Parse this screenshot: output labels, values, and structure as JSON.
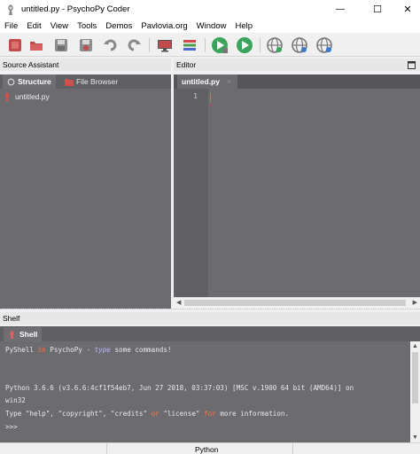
{
  "window": {
    "title": "untitled.py - PsychoPy Coder",
    "minimize_glyph": "—",
    "maximize_glyph": "☐",
    "close_glyph": "✕"
  },
  "menu": [
    "File",
    "Edit",
    "View",
    "Tools",
    "Demos",
    "Pavlovia.org",
    "Window",
    "Help"
  ],
  "toolbar": {
    "icons": [
      "new-file-icon",
      "open-folder-icon",
      "save-icon",
      "save-as-icon",
      "undo-icon",
      "redo-icon",
      "monitor-icon",
      "color-picker-icon",
      "run-icon",
      "run-green-icon",
      "pavlovia-sync-icon",
      "pavlovia-search-icon",
      "pavlovia-user-icon"
    ]
  },
  "source_assistant": {
    "header": "Source Assistant",
    "tabs": [
      {
        "label": "Structure",
        "active": true
      },
      {
        "label": "File Browser",
        "active": false
      }
    ],
    "tree": [
      {
        "label": "untitled.py"
      }
    ]
  },
  "editor": {
    "header": "Editor",
    "tab_label": "untitled.py",
    "tab_close": "×",
    "line_number": "1"
  },
  "shelf": {
    "header": "Shelf",
    "tab_label": "Shell",
    "lines": {
      "l1_a": "PyShell ",
      "l1_in": "in",
      "l1_b": " PsychoPy - ",
      "l1_type": "type",
      "l1_c": " some commands!",
      "l2": "Python 3.6.6 (v3.6.6:4cf1f54eb7, Jun 27 2018, 03:37:03) [MSC v.1900 64 bit (AMD64)] on",
      "l3": "win32",
      "l4_a": "Type \"help\", \"copyright\", \"credits\" ",
      "l4_or": "or",
      "l4_b": " \"license\" ",
      "l4_for": "for",
      "l4_c": " more information.",
      "l5": ">>>"
    }
  },
  "status": {
    "language": "Python"
  },
  "colors": {
    "dark_pane": "#6b6b70",
    "keyword": "#ff7a3c",
    "caret": "#ff5c5c"
  }
}
